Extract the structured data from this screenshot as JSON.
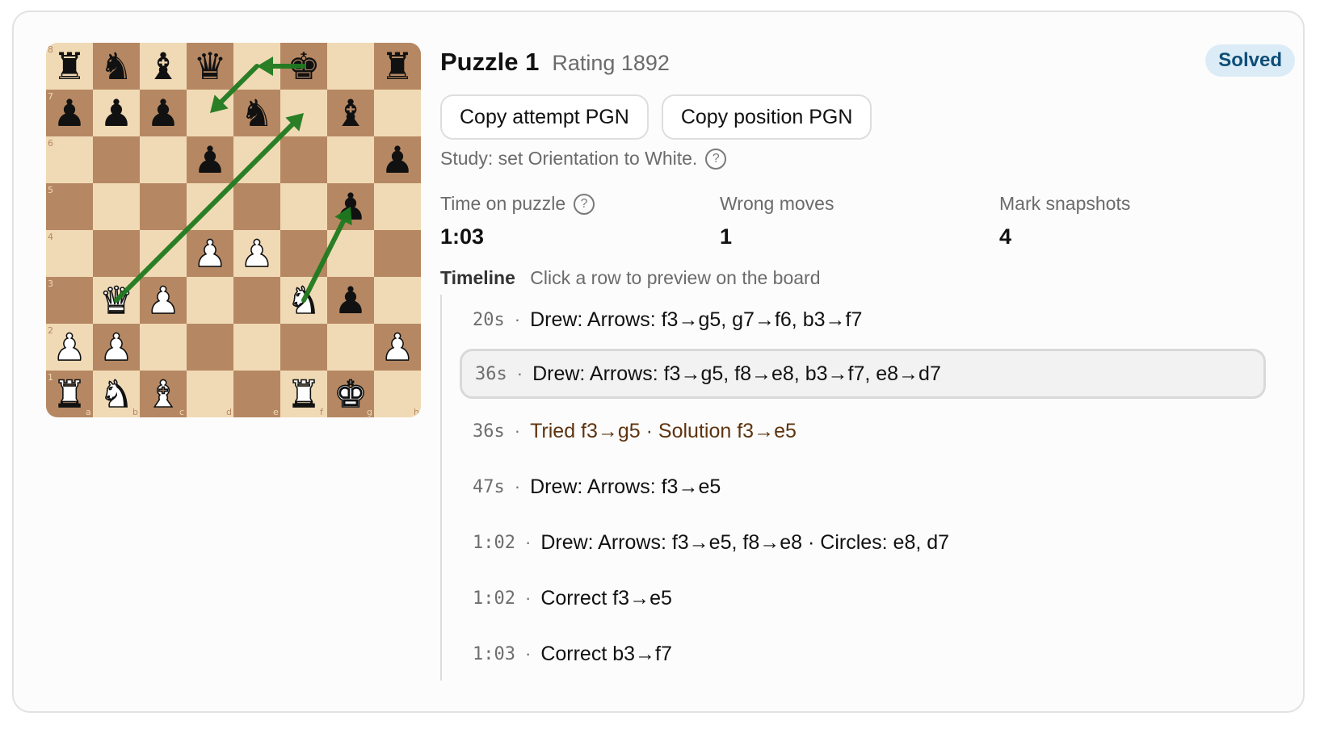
{
  "board": {
    "files": [
      "a",
      "b",
      "c",
      "d",
      "e",
      "f",
      "g",
      "h"
    ],
    "ranks": [
      "8",
      "7",
      "6",
      "5",
      "4",
      "3",
      "2",
      "1"
    ],
    "light_color": "#f0dab5",
    "dark_color": "#b58863",
    "pieces": [
      {
        "square": "a8",
        "piece": "rook",
        "color": "black"
      },
      {
        "square": "b8",
        "piece": "knight",
        "color": "black"
      },
      {
        "square": "c8",
        "piece": "bishop",
        "color": "black"
      },
      {
        "square": "d8",
        "piece": "queen",
        "color": "black"
      },
      {
        "square": "f8",
        "piece": "king",
        "color": "black"
      },
      {
        "square": "h8",
        "piece": "rook",
        "color": "black"
      },
      {
        "square": "a7",
        "piece": "pawn",
        "color": "black"
      },
      {
        "square": "b7",
        "piece": "pawn",
        "color": "black"
      },
      {
        "square": "c7",
        "piece": "pawn",
        "color": "black"
      },
      {
        "square": "e7",
        "piece": "knight",
        "color": "black"
      },
      {
        "square": "g7",
        "piece": "bishop",
        "color": "black"
      },
      {
        "square": "d6",
        "piece": "pawn",
        "color": "black"
      },
      {
        "square": "h6",
        "piece": "pawn",
        "color": "black"
      },
      {
        "square": "g5",
        "piece": "pawn",
        "color": "black"
      },
      {
        "square": "d4",
        "piece": "pawn",
        "color": "white"
      },
      {
        "square": "e4",
        "piece": "pawn",
        "color": "white"
      },
      {
        "square": "b3",
        "piece": "queen",
        "color": "white"
      },
      {
        "square": "c3",
        "piece": "pawn",
        "color": "white"
      },
      {
        "square": "f3",
        "piece": "knight",
        "color": "white"
      },
      {
        "square": "g3",
        "piece": "pawn",
        "color": "black"
      },
      {
        "square": "a2",
        "piece": "pawn",
        "color": "white"
      },
      {
        "square": "b2",
        "piece": "pawn",
        "color": "white"
      },
      {
        "square": "h2",
        "piece": "pawn",
        "color": "white"
      },
      {
        "square": "a1",
        "piece": "rook",
        "color": "white"
      },
      {
        "square": "b1",
        "piece": "knight",
        "color": "white"
      },
      {
        "square": "c1",
        "piece": "bishop",
        "color": "white"
      },
      {
        "square": "f1",
        "piece": "rook",
        "color": "white"
      },
      {
        "square": "g1",
        "piece": "king",
        "color": "white"
      }
    ],
    "arrows": [
      {
        "from": "f3",
        "to": "g5"
      },
      {
        "from": "f8",
        "to": "e8"
      },
      {
        "from": "b3",
        "to": "f7"
      },
      {
        "from": "e8",
        "to": "d7"
      }
    ],
    "arrow_color": "#1f7a1f"
  },
  "header": {
    "title": "Puzzle 1",
    "rating": "Rating 1892",
    "status_badge": "Solved"
  },
  "actions": {
    "copy_attempt": "Copy attempt PGN",
    "copy_position": "Copy position PGN"
  },
  "study_hint": "Study: set Orientation to White.",
  "help_icon": "question-circle-icon",
  "stats": {
    "time": {
      "label": "Time on puzzle",
      "value": "1:03"
    },
    "wrong": {
      "label": "Wrong moves",
      "value": "1"
    },
    "snapshots": {
      "label": "Mark snapshots",
      "value": "4"
    }
  },
  "timeline": {
    "title": "Timeline",
    "hint": "Click a row to preview on the board",
    "rows": [
      {
        "time": "20s",
        "text": "Drew: Arrows: f3→g5, g7→f6, b3→f7",
        "type": "drawing",
        "selected": false
      },
      {
        "time": "36s",
        "text": "Drew: Arrows: f3→g5, f8→e8, b3→f7, e8→d7",
        "type": "drawing",
        "selected": true
      },
      {
        "time": "36s",
        "text": "Tried f3→g5 · Solution f3→e5",
        "type": "error",
        "selected": false
      },
      {
        "time": "47s",
        "text": "Drew: Arrows: f3→e5",
        "type": "drawing",
        "selected": false
      },
      {
        "time": "1:02",
        "text": "Drew: Arrows: f3→e5, f8→e8 · Circles: e8, d7",
        "type": "drawing",
        "selected": false
      },
      {
        "time": "1:02",
        "text": "Correct f3→e5",
        "type": "correct",
        "selected": false
      },
      {
        "time": "1:03",
        "text": "Correct b3→f7",
        "type": "correct",
        "selected": false
      }
    ]
  }
}
